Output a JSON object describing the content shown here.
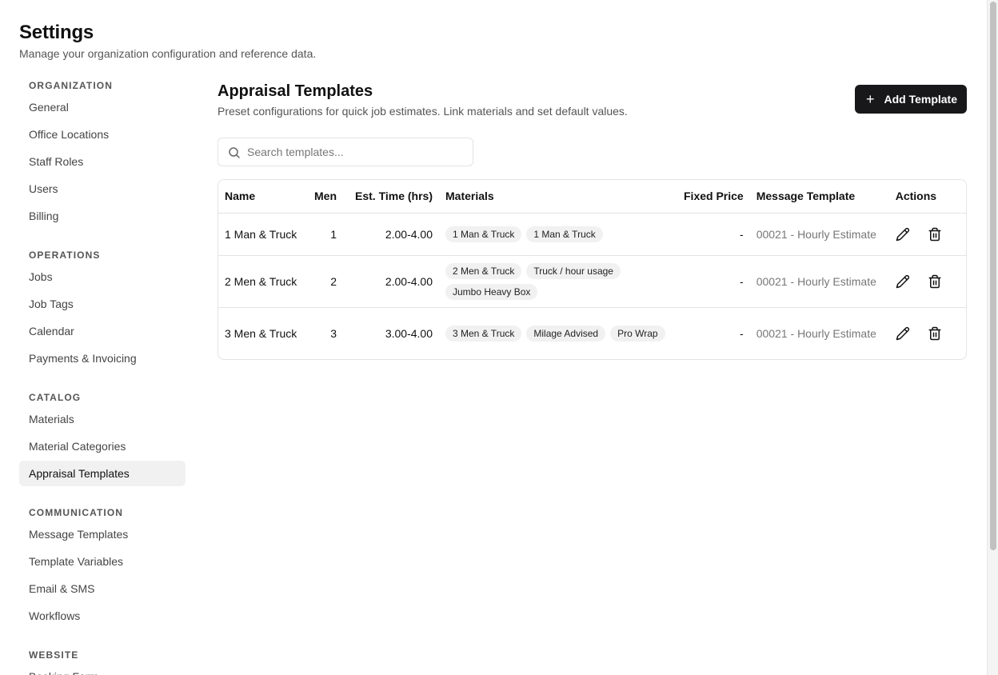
{
  "page": {
    "title": "Settings",
    "subtitle": "Manage your organization configuration and reference data."
  },
  "sidebar": {
    "sections": [
      {
        "title": "ORGANIZATION",
        "items": [
          "General",
          "Office Locations",
          "Staff Roles",
          "Users",
          "Billing"
        ]
      },
      {
        "title": "OPERATIONS",
        "items": [
          "Jobs",
          "Job Tags",
          "Calendar",
          "Payments & Invoicing"
        ]
      },
      {
        "title": "CATALOG",
        "items": [
          "Materials",
          "Material Categories",
          "Appraisal Templates"
        ]
      },
      {
        "title": "COMMUNICATION",
        "items": [
          "Message Templates",
          "Template Variables",
          "Email & SMS",
          "Workflows"
        ]
      },
      {
        "title": "WEBSITE",
        "items": [
          "Booking Form"
        ]
      }
    ],
    "active_item": "Appraisal Templates"
  },
  "main": {
    "title": "Appraisal Templates",
    "subtitle": "Preset configurations for quick job estimates. Link materials and set default values.",
    "add_button_label": "Add Template",
    "search_placeholder": "Search templates...",
    "columns": [
      "Name",
      "Men",
      "Est. Time (hrs)",
      "Materials",
      "Fixed Price",
      "Message Template",
      "Actions"
    ],
    "rows": [
      {
        "name": "1 Man & Truck",
        "men": "1",
        "time": "2.00-4.00",
        "materials": [
          "1 Man & Truck",
          "1 Man & Truck"
        ],
        "fixed_price": "-",
        "message_template": "00021 - Hourly Estimate"
      },
      {
        "name": "2 Men & Truck",
        "men": "2",
        "time": "2.00-4.00",
        "materials": [
          "2 Men & Truck",
          "Truck / hour usage",
          "Jumbo Heavy Box"
        ],
        "fixed_price": "-",
        "message_template": "00021 - Hourly Estimate"
      },
      {
        "name": "3 Men & Truck",
        "men": "3",
        "time": "3.00-4.00",
        "materials": [
          "3 Men & Truck",
          "Milage Advised",
          "Pro Wrap"
        ],
        "fixed_price": "-",
        "message_template": "00021 - Hourly Estimate"
      }
    ]
  },
  "icons": {
    "search": "search-icon",
    "add": "plus-icon",
    "edit": "pencil-icon",
    "delete": "trash-icon"
  },
  "colors": {
    "primary_button": "#18181b",
    "active_nav_bg": "#f1f1f2",
    "tag_bg": "#f1f1f2",
    "border": "#e4e4e7"
  }
}
